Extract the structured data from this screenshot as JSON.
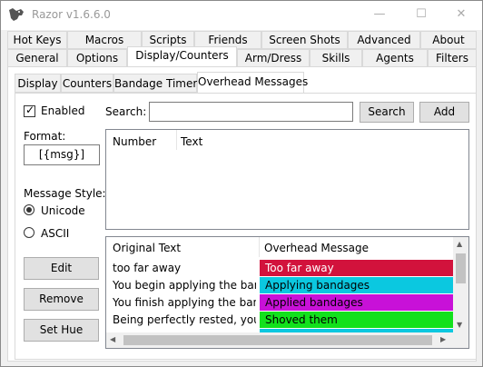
{
  "window": {
    "title": "Razor v1.6.6.0",
    "minimize_glyph": "—",
    "maximize_glyph": "☐",
    "close_glyph": "✕"
  },
  "tabs_row1": [
    "Hot Keys",
    "Macros",
    "Scripts",
    "Friends",
    "Screen Shots",
    "Advanced",
    "About"
  ],
  "tabs_row2": [
    "General",
    "Options",
    "Display/Counters",
    "Arm/Dress",
    "Skills",
    "Agents",
    "Filters"
  ],
  "subtabs": [
    "Display",
    "Counters",
    "Bandage Timer",
    "Overhead Messages"
  ],
  "panel": {
    "enabled_label": "Enabled",
    "enabled_checked": true,
    "search_label": "Search:",
    "search_value": "",
    "search_button": "Search",
    "add_button": "Add",
    "format_label": "Format:",
    "format_value": "[{msg}]",
    "message_style_label": "Message Style:",
    "unicode_label": "Unicode",
    "ascii_label": "ASCII",
    "selected_style": "Unicode",
    "edit_button": "Edit",
    "remove_button": "Remove",
    "sethue_button": "Set Hue"
  },
  "top_list": {
    "columns": [
      "Number",
      "Text"
    ]
  },
  "bottom_list": {
    "columns": [
      "Original Text",
      "Overhead Message"
    ],
    "rows": [
      {
        "original": "too far away",
        "message": "Too far away",
        "color": "#d2123c",
        "text_color": "#ffffff"
      },
      {
        "original": "You begin applying the ban...",
        "message": "Applying bandages",
        "color": "#0bc8e0",
        "text_color": "#000000"
      },
      {
        "original": "You finish applying the band...",
        "message": "Applied bandages",
        "color": "#c811d8",
        "text_color": "#000000"
      },
      {
        "original": "Being perfectly rested, you s...",
        "message": "Shoved them",
        "color": "#12e11c",
        "text_color": "#000000"
      }
    ]
  },
  "icons": {
    "app_icon": "wolf-icon",
    "checkmark": "✓",
    "scroll_up": "▲",
    "scroll_down": "▼",
    "scroll_left": "◀",
    "scroll_right": "▶"
  }
}
